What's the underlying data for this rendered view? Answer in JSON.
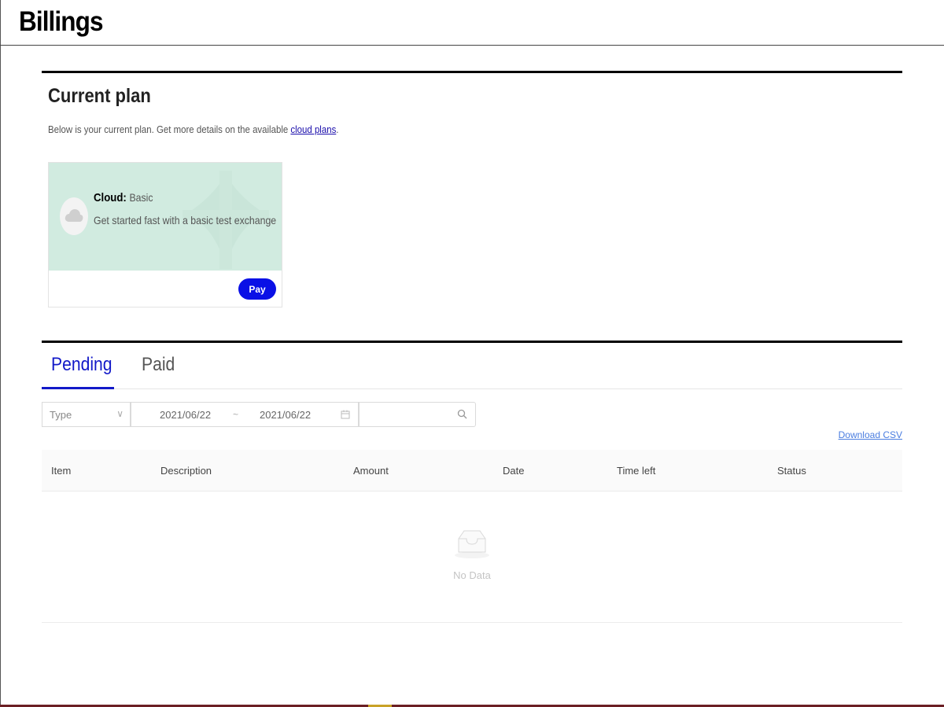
{
  "header": {
    "title": "Billings"
  },
  "current_plan": {
    "title": "Current plan",
    "intro_text": "Below is your current plan. Get more details on the available ",
    "intro_link": "cloud plans",
    "intro_end": ".",
    "card": {
      "plan_label": "Cloud:",
      "plan_tier": "Basic",
      "description": "Get started fast with a basic test exchange",
      "icon": "cloud-icon",
      "pay_label": "Pay"
    },
    "colors": {
      "banner": "#d1ebe0",
      "pay_button": "#0a10e6"
    }
  },
  "tabs": [
    {
      "label": "Pending",
      "active": true
    },
    {
      "label": "Paid",
      "active": false
    }
  ],
  "filters": {
    "type_placeholder": "Type",
    "date_start": "2021/06/22",
    "date_separator": "~",
    "date_end": "2021/06/22",
    "search_placeholder": ""
  },
  "download_csv": "Download CSV",
  "table": {
    "columns": [
      "Item",
      "Description",
      "Amount",
      "Date",
      "Time left",
      "Status"
    ],
    "rows": [],
    "empty_text": "No Data"
  }
}
